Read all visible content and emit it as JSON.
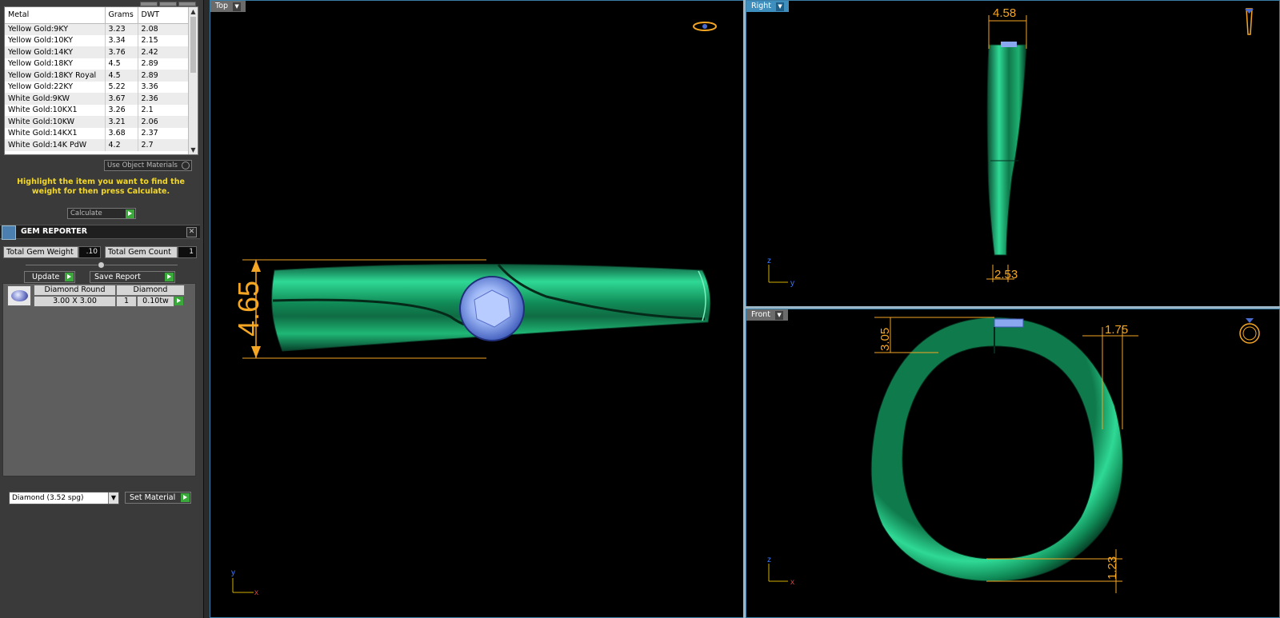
{
  "metal_table": {
    "headers": [
      "Metal",
      "Grams",
      "DWT"
    ],
    "rows": [
      [
        "Yellow Gold:9KY",
        "3.23",
        "2.08"
      ],
      [
        "Yellow Gold:10KY",
        "3.34",
        "2.15"
      ],
      [
        "Yellow Gold:14KY",
        "3.76",
        "2.42"
      ],
      [
        "Yellow Gold:18KY",
        "4.5",
        "2.89"
      ],
      [
        "Yellow Gold:18KY Royal",
        "4.5",
        "2.89"
      ],
      [
        "Yellow Gold:22KY",
        "5.22",
        "3.36"
      ],
      [
        "White Gold:9KW",
        "3.67",
        "2.36"
      ],
      [
        "White Gold:10KX1",
        "3.26",
        "2.1"
      ],
      [
        "White Gold:10KW",
        "3.21",
        "2.06"
      ],
      [
        "White Gold:14KX1",
        "3.68",
        "2.37"
      ],
      [
        "White Gold:14K PdW",
        "4.2",
        "2.7"
      ]
    ]
  },
  "use_object_materials_label": "Use Object Materials",
  "instructions": "Highlight the item you want to find the weight for then press Calculate.",
  "calculate_label": "Calculate",
  "gem_reporter": {
    "title": "GEM REPORTER",
    "close": "✕",
    "total_weight_label": "Total Gem Weight",
    "total_weight_value": ".10",
    "total_count_label": "Total Gem Count",
    "total_count_value": "1",
    "update_label": "Update",
    "save_report_label": "Save Report",
    "gem_row": {
      "name": "Diamond Round",
      "type": "Diamond",
      "size": "3.00 X 3.00",
      "count": "1",
      "weight": "0.10tw"
    },
    "material_select": "Diamond    (3.52 spg)",
    "set_material_label": "Set Material"
  },
  "viewports": {
    "top": {
      "label": "Top",
      "dim": "4.65",
      "axis_y": "y",
      "axis_x": "x"
    },
    "right": {
      "label": "Right",
      "dim_top": "4.58",
      "dim_bottom": "2.53",
      "axis_z": "z",
      "axis_y": "y"
    },
    "front": {
      "label": "Front",
      "dim_left": "3.05",
      "dim_right": "1.75",
      "dim_bottom": "1.23",
      "axis_z": "z",
      "axis_x": "x"
    }
  },
  "colors": {
    "ring_green": "#14a36a",
    "dimension_orange": "#f5a623",
    "gem_blue": "#8aa8f0",
    "active_tab": "#3f8fbe",
    "instruction_yellow": "#f3d82a"
  }
}
